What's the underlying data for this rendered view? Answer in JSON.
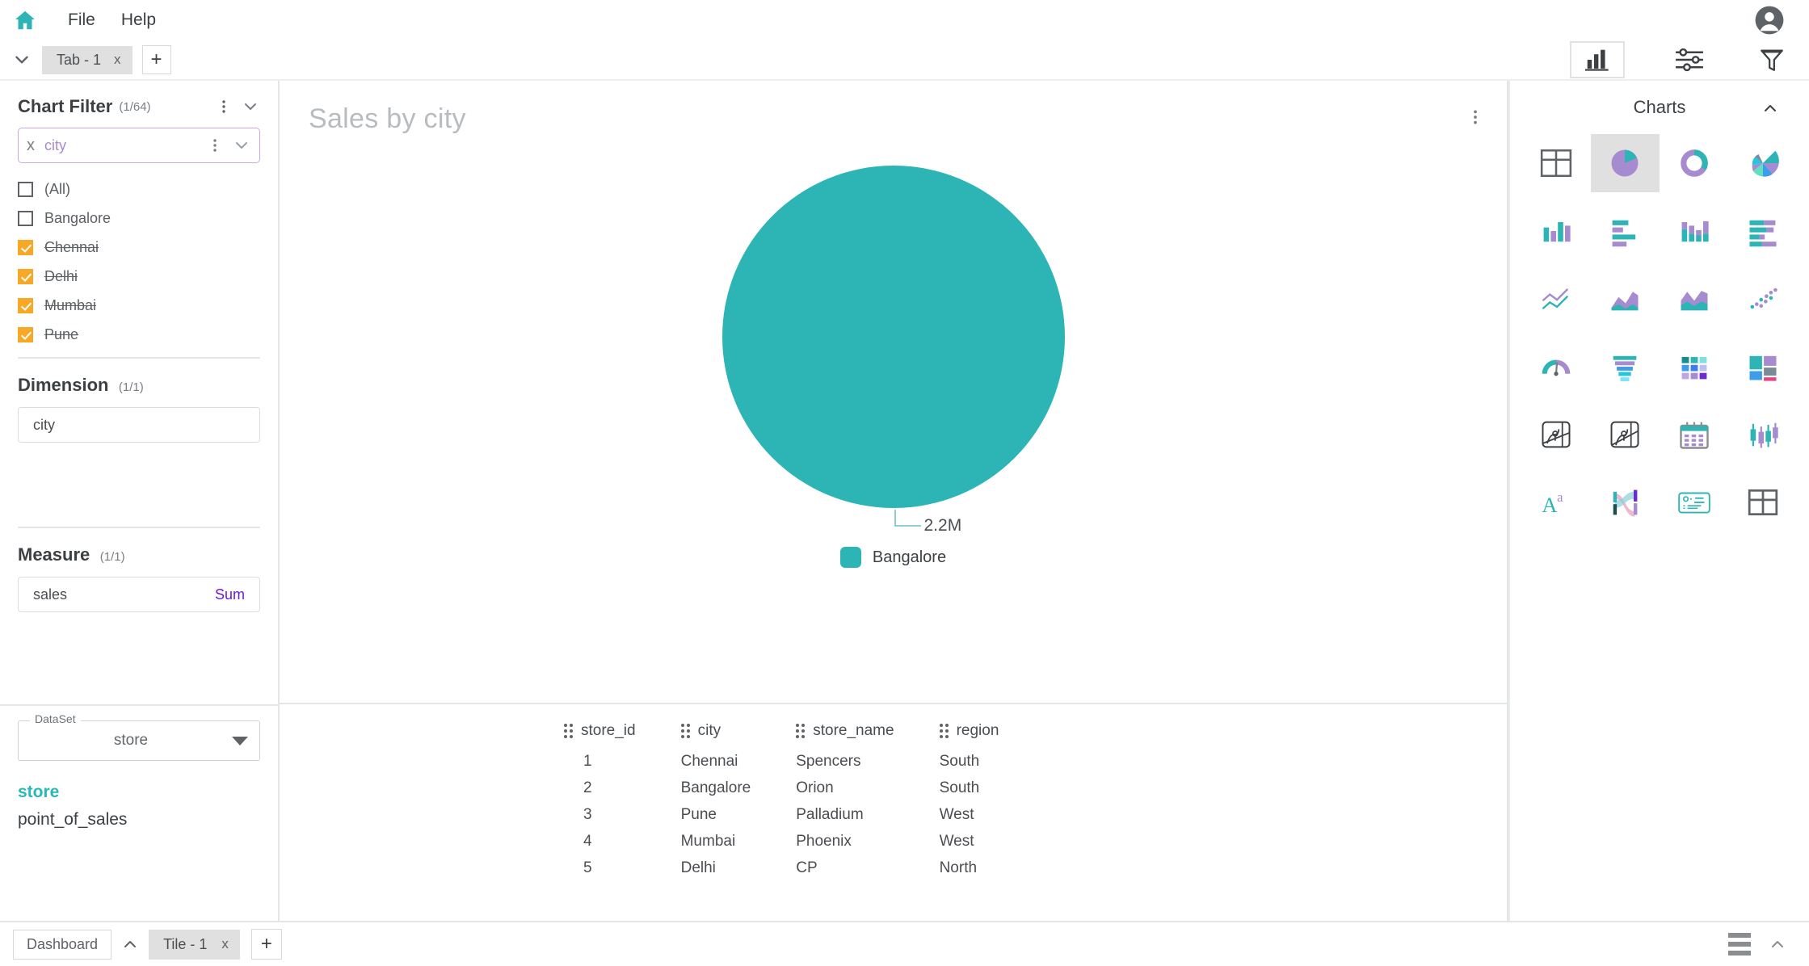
{
  "menubar": {
    "home_icon": "home-icon",
    "items": [
      {
        "label": "File"
      },
      {
        "label": "Help"
      }
    ],
    "account_icon": "account-avatar-icon"
  },
  "tabbar": {
    "collapse_icon": "chevron-down-icon",
    "tabs": [
      {
        "label": "Tab - 1",
        "close": "x"
      }
    ],
    "add_label": "+",
    "tools": [
      {
        "name": "chart-panel-toggle",
        "icon": "bar-chart-icon",
        "active": true
      },
      {
        "name": "settings-toggle",
        "icon": "sliders-icon",
        "active": false
      },
      {
        "name": "filter-toggle",
        "icon": "funnel-icon",
        "active": false
      }
    ]
  },
  "filter_pane": {
    "title": "Chart Filter",
    "count": "(1/64)",
    "kebab_icon": "more-vertical-icon",
    "chevron_icon": "chevron-down-icon",
    "select": {
      "clear_icon": "x",
      "value": "city",
      "kebab_icon": "more-vertical-icon",
      "chevron_icon": "chevron-down-icon"
    },
    "options": [
      {
        "label": "(All)",
        "checked": false,
        "struck": false
      },
      {
        "label": "Bangalore",
        "checked": false,
        "struck": false
      },
      {
        "label": "Chennai",
        "checked": true,
        "struck": true
      },
      {
        "label": "Delhi",
        "checked": true,
        "struck": true
      },
      {
        "label": "Mumbai",
        "checked": true,
        "struck": true
      },
      {
        "label": "Pune",
        "checked": true,
        "struck": true
      }
    ],
    "dimension": {
      "title": "Dimension",
      "count": "(1/1)",
      "field": "city"
    },
    "measure": {
      "title": "Measure",
      "count": "(1/1)",
      "field": "sales",
      "aggregation": "Sum"
    }
  },
  "dataset": {
    "legend": "DataSet",
    "selected": "store",
    "caret_icon": "caret-down-icon",
    "tables": [
      {
        "name": "store",
        "active": true
      },
      {
        "name": "point_of_sales",
        "active": false
      }
    ]
  },
  "chart": {
    "title": "Sales by city",
    "kebab_icon": "more-vertical-icon"
  },
  "chart_data": {
    "type": "pie",
    "title": "Sales by city",
    "categories": [
      "Bangalore"
    ],
    "values": [
      2200000
    ],
    "value_labels": [
      "2.2M"
    ],
    "percentages": [
      100
    ],
    "colors": [
      "#2db5b5"
    ],
    "legend": [
      "Bangalore"
    ],
    "legend_position": "bottom",
    "xlabel": "",
    "ylabel": "",
    "note": "Single full-circle slice; cities Chennai, Delhi, Mumbai and Pune are excluded by the chart filter"
  },
  "data_table": {
    "columns": [
      "store_id",
      "city",
      "store_name",
      "region"
    ],
    "rows": [
      [
        "1",
        "Chennai",
        "Spencers",
        "South"
      ],
      [
        "2",
        "Bangalore",
        "Orion",
        "South"
      ],
      [
        "3",
        "Pune",
        "Palladium",
        "West"
      ],
      [
        "4",
        "Mumbai",
        "Phoenix",
        "West"
      ],
      [
        "5",
        "Delhi",
        "CP",
        "North"
      ]
    ]
  },
  "charts_panel": {
    "title": "Charts",
    "collapse_icon": "chevron-up-icon",
    "items": [
      {
        "name": "table-chart",
        "selected": false
      },
      {
        "name": "pie-chart",
        "selected": true
      },
      {
        "name": "donut-chart",
        "selected": false
      },
      {
        "name": "rose-chart",
        "selected": false
      },
      {
        "name": "column-chart",
        "selected": false
      },
      {
        "name": "bar-chart",
        "selected": false
      },
      {
        "name": "stacked-column-chart",
        "selected": false
      },
      {
        "name": "stacked-bar-chart",
        "selected": false
      },
      {
        "name": "line-chart",
        "selected": false
      },
      {
        "name": "area-chart",
        "selected": false
      },
      {
        "name": "stacked-area-chart",
        "selected": false
      },
      {
        "name": "scatter-chart",
        "selected": false
      },
      {
        "name": "gauge-chart",
        "selected": false
      },
      {
        "name": "funnel-chart",
        "selected": false
      },
      {
        "name": "heatmap-chart",
        "selected": false
      },
      {
        "name": "treemap-chart",
        "selected": false
      },
      {
        "name": "map-chart",
        "selected": false
      },
      {
        "name": "filled-map-chart",
        "selected": false
      },
      {
        "name": "calendar-chart",
        "selected": false
      },
      {
        "name": "candlestick-chart",
        "selected": false
      },
      {
        "name": "word-cloud-chart",
        "selected": false
      },
      {
        "name": "sankey-chart",
        "selected": false
      },
      {
        "name": "card-chart",
        "selected": false
      },
      {
        "name": "pivot-table-chart",
        "selected": false
      }
    ]
  },
  "bottombar": {
    "dashboard_label": "Dashboard",
    "collapse_icon": "chevron-up-icon",
    "tiles": [
      {
        "label": "Tile - 1",
        "close": "x"
      }
    ],
    "add_label": "+",
    "menu_icon": "hamburger-icon",
    "expand_icon": "chevron-up-icon"
  },
  "colors": {
    "teal": "#2db5b5",
    "purple": "#a78bd0",
    "orange": "#f9a825",
    "accent_violet": "#6a1bd1"
  }
}
